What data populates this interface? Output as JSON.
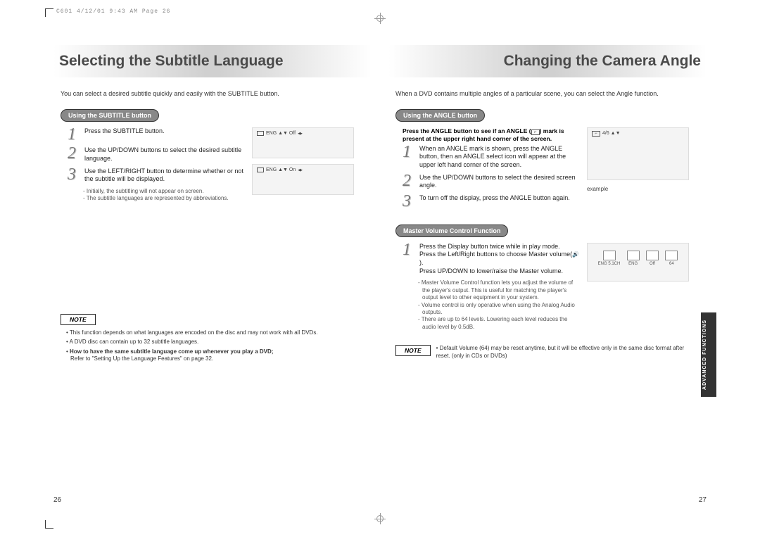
{
  "header_info": "C601  4/12/01 9:43 AM  Page 26",
  "left": {
    "title": "Selecting the Subtitle Language",
    "intro": "You can select a desired subtitle quickly and easily with the SUBTITLE button.",
    "pill": "Using the SUBTITLE button",
    "step1": "Press the SUBTITLE button.",
    "step2": "Use the UP/DOWN buttons to select the desired subtitle language.",
    "step3": "Use the LEFT/RIGHT button to determine whether or not the subtitle will be displayed.",
    "subnote1": "Initially, the subtitling will not appear on screen.",
    "subnote2": "The subtitle languages are represented by abbreviations.",
    "osd_off": "ENG ▲▼ Off",
    "osd_on": "ENG ▲▼ On",
    "note_label": "NOTE",
    "note1": "This function depends on what languages are encoded on the disc and may not work with all DVDs.",
    "note2": "A DVD disc can contain up to 32 subtitle languages.",
    "note3_bold": "How to have the same subtitle language come up whenever you play a DVD;",
    "note3_rest": "Refer to \"Setting Up the Language Features\" on page 32.",
    "page_num": "26"
  },
  "right": {
    "title": "Changing the Camera Angle",
    "intro": "When a DVD contains multiple angles of a particular scene, you can select the Angle function.",
    "pill1": "Using the ANGLE button",
    "angle_press_bold": "Press the ANGLE button to see if an ANGLE (",
    "angle_press_bold2": ") mark is present at the upper right hand corner of the screen.",
    "step1": "When an ANGLE mark is shown, press the ANGLE button, then an ANGLE select icon will appear at the upper left hand corner of the screen.",
    "step2": "Use the UP/DOWN buttons to select the desired screen angle.",
    "step3": "To turn off the display, press the ANGLE button again.",
    "osd_angle": "4/6 ▲▼",
    "example": "example",
    "pill2": "Master Volume Control Function",
    "mv_step1a": "Press the Display button twice while in play mode.",
    "mv_step1b": "Press the Left/Right buttons to choose Master volume(",
    "mv_step1c": ").",
    "mv_step1d": "Press UP/DOWN to lower/raise the Master volume.",
    "mv_note1": "Master Volume Control function lets you adjust the volume of the player's output. This is useful for matching the player's output level to other equipment in your system.",
    "mv_note2": "Volume control is only operative when using the Analog Audio outputs.",
    "mv_note3": "There are up to 64 levels. Lowering each level reduces the audio level by 0.5dB.",
    "vol_lbl1": "ENG 5.1CH",
    "vol_lbl2": "ENG",
    "vol_lbl3": "Off",
    "vol_lbl4": "64",
    "side_tab": "ADVANCED FUNCTIONS",
    "note_label": "NOTE",
    "bottom_note": "Default Volume (64) may be reset anytime, but it will be effective only in the same disc format after reset. (only in CDs or DVDs)",
    "page_num": "27"
  }
}
